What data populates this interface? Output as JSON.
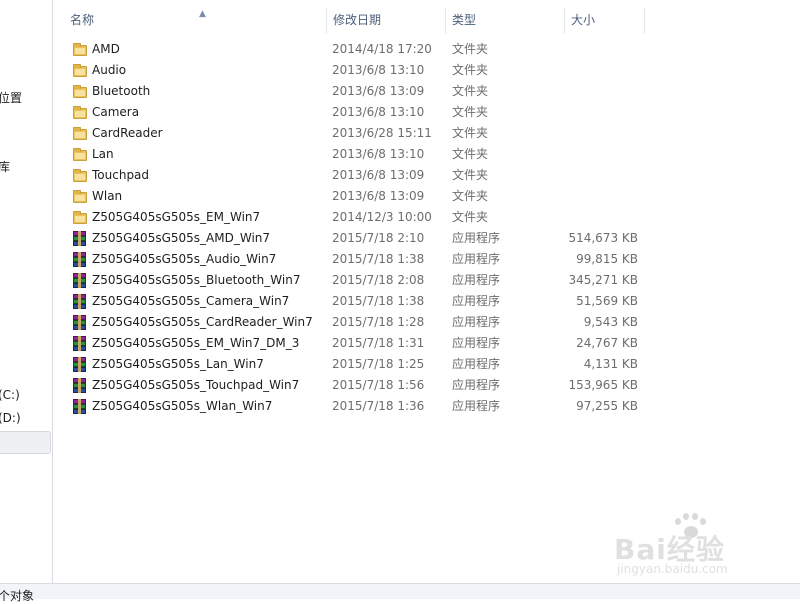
{
  "nav": {
    "items": [
      {
        "label": "的位置"
      },
      {
        "label": "视库"
      },
      {
        "label": "库"
      },
      {
        "label": "(C:)"
      },
      {
        "label": "(D:)"
      }
    ]
  },
  "columns": {
    "name": "名称",
    "date": "修改日期",
    "type": "类型",
    "size": "大小"
  },
  "files": [
    {
      "name": "AMD",
      "date": "2014/4/18 17:20",
      "type": "文件夹",
      "size": "",
      "icon": "folder-icon"
    },
    {
      "name": "Audio",
      "date": "2013/6/8 13:10",
      "type": "文件夹",
      "size": "",
      "icon": "folder-icon"
    },
    {
      "name": "Bluetooth",
      "date": "2013/6/8 13:09",
      "type": "文件夹",
      "size": "",
      "icon": "folder-icon"
    },
    {
      "name": "Camera",
      "date": "2013/6/8 13:10",
      "type": "文件夹",
      "size": "",
      "icon": "folder-icon"
    },
    {
      "name": "CardReader",
      "date": "2013/6/28 15:11",
      "type": "文件夹",
      "size": "",
      "icon": "folder-icon"
    },
    {
      "name": "Lan",
      "date": "2013/6/8 13:10",
      "type": "文件夹",
      "size": "",
      "icon": "folder-icon"
    },
    {
      "name": "Touchpad",
      "date": "2013/6/8 13:09",
      "type": "文件夹",
      "size": "",
      "icon": "folder-icon"
    },
    {
      "name": "Wlan",
      "date": "2013/6/8 13:09",
      "type": "文件夹",
      "size": "",
      "icon": "folder-icon"
    },
    {
      "name": "Z505G405sG505s_EM_Win7",
      "date": "2014/12/3 10:00",
      "type": "文件夹",
      "size": "",
      "icon": "folder-icon"
    },
    {
      "name": "Z505G405sG505s_AMD_Win7",
      "date": "2015/7/18 2:10",
      "type": "应用程序",
      "size": "514,673 KB",
      "icon": "archive-icon"
    },
    {
      "name": "Z505G405sG505s_Audio_Win7",
      "date": "2015/7/18 1:38",
      "type": "应用程序",
      "size": "99,815 KB",
      "icon": "archive-icon"
    },
    {
      "name": "Z505G405sG505s_Bluetooth_Win7",
      "date": "2015/7/18 2:08",
      "type": "应用程序",
      "size": "345,271 KB",
      "icon": "archive-icon"
    },
    {
      "name": "Z505G405sG505s_Camera_Win7",
      "date": "2015/7/18 1:38",
      "type": "应用程序",
      "size": "51,569 KB",
      "icon": "archive-icon"
    },
    {
      "name": "Z505G405sG505s_CardReader_Win7",
      "date": "2015/7/18 1:28",
      "type": "应用程序",
      "size": "9,543 KB",
      "icon": "archive-icon"
    },
    {
      "name": "Z505G405sG505s_EM_Win7_DM_3",
      "date": "2015/7/18 1:31",
      "type": "应用程序",
      "size": "24,767 KB",
      "icon": "archive-icon"
    },
    {
      "name": "Z505G405sG505s_Lan_Win7",
      "date": "2015/7/18 1:25",
      "type": "应用程序",
      "size": "4,131 KB",
      "icon": "archive-icon"
    },
    {
      "name": "Z505G405sG505s_Touchpad_Win7",
      "date": "2015/7/18 1:56",
      "type": "应用程序",
      "size": "153,965 KB",
      "icon": "archive-icon"
    },
    {
      "name": "Z505G405sG505s_Wlan_Win7",
      "date": "2015/7/18 1:36",
      "type": "应用程序",
      "size": "97,255 KB",
      "icon": "archive-icon"
    }
  ],
  "status": {
    "text": "个对象"
  },
  "watermark": {
    "brand": "Bai经验",
    "url": "jingyan.baidu.com"
  },
  "colors": {
    "header_text": "#4c607a",
    "secondary_text": "#6d6d6d",
    "folder": "#e9c35a"
  }
}
